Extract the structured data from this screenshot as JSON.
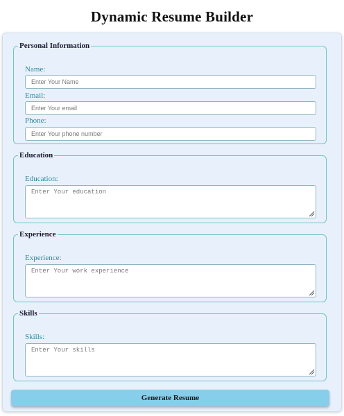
{
  "page": {
    "title": "Dynamic Resume Builder"
  },
  "form": {
    "personal": {
      "legend": "Personal Information",
      "name_label": "Name:",
      "name_placeholder": "Enter Your Name",
      "email_label": "Email:",
      "email_placeholder": "Enter Your email",
      "phone_label": "Phone:",
      "phone_placeholder": "Enter Your phone number"
    },
    "education": {
      "legend": "Education",
      "label": "Education:",
      "placeholder": "Enter Your education"
    },
    "experience": {
      "legend": "Experience",
      "label": "Experience:",
      "placeholder": "Enter Your work experience"
    },
    "skills": {
      "legend": "Skills",
      "label": "Skills:",
      "placeholder": "Enter Your skills"
    },
    "submit_label": "Generate Resume"
  },
  "icons": {
    "textarea_resize": "resize-handle-icon"
  },
  "colors": {
    "card_background": "#e8f1fb",
    "section_border": "#6ec3c9",
    "label_text": "#2b8aa0",
    "button_background": "#87ceeb"
  }
}
